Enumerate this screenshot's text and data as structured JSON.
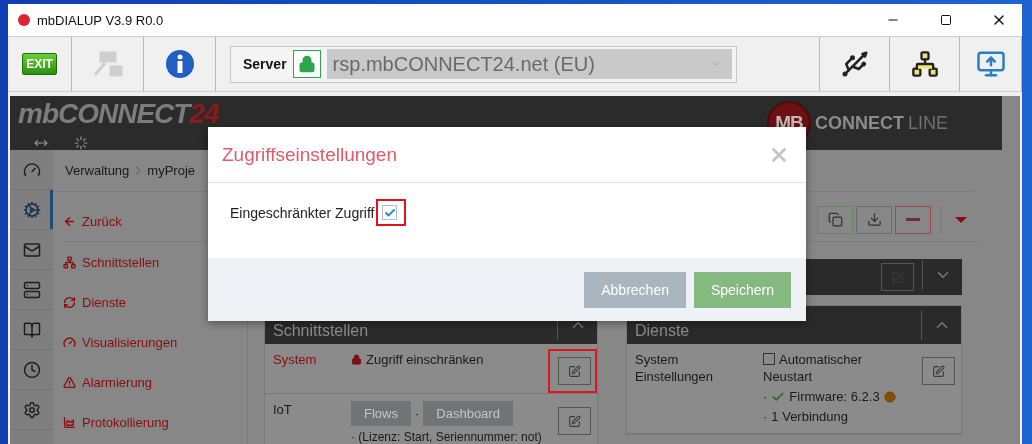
{
  "window": {
    "title": "mbDIALUP V3.9 R0.0"
  },
  "toolbar": {
    "buttons": [
      {
        "kind": "exit",
        "label": "EXIT",
        "disabled": false
      },
      {
        "kind": "connect",
        "disabled": true
      },
      {
        "kind": "info",
        "disabled": false
      }
    ],
    "server": {
      "label": "Server",
      "secure": true,
      "value": "rsp.mbCONNECT24.net (EU)"
    },
    "tools": [
      {
        "kind": "usb"
      },
      {
        "kind": "network"
      },
      {
        "kind": "remote"
      }
    ]
  },
  "header": {
    "logo": "mbCONNECT",
    "logo_accent": "24",
    "brand_mark": "MB",
    "brand_bold": "CONNECT",
    "brand_light": "LINE"
  },
  "sidebar": [
    {
      "kind": "gauge",
      "selected": false
    },
    {
      "kind": "gears",
      "selected": true
    },
    {
      "kind": "mail",
      "selected": false
    },
    {
      "kind": "server",
      "selected": false
    },
    {
      "kind": "book",
      "selected": false
    },
    {
      "kind": "clock",
      "selected": false
    },
    {
      "kind": "gear",
      "selected": false
    }
  ],
  "breadcrumb": [
    "Verwaltung",
    "myProje"
  ],
  "menu": [
    {
      "kind": "back",
      "label": "Zurück"
    },
    {
      "kind": "sitemap",
      "label": "Schnittstellen"
    },
    {
      "kind": "refresh",
      "label": "Dienste"
    },
    {
      "kind": "gauge",
      "label": "Visualisierungen"
    },
    {
      "kind": "warning",
      "label": "Alarmierung"
    },
    {
      "kind": "chart",
      "label": "Protokollierung"
    }
  ],
  "actions": [
    {
      "kind": "copy"
    },
    {
      "kind": "download"
    },
    {
      "kind": "remove"
    },
    {
      "kind": "more"
    }
  ],
  "collapsed_bar": {
    "expanded": false
  },
  "panels": [
    {
      "title": "Schnittstellen",
      "expanded": true,
      "rows": [
        {
          "label": "System",
          "link": true,
          "locked": true,
          "text": "Zugriff einschränken",
          "highlighted": true
        },
        {
          "label": "IoT",
          "link": false,
          "buttons": [
            "Flows",
            "Dashboard"
          ],
          "separator": "·",
          "note": "· (Lizenz: Start, Seriennummer: not)",
          "highlighted": false
        }
      ]
    },
    {
      "title": "Dienste",
      "expanded": true,
      "rows": [
        {
          "label": "System Einstellungen",
          "link": false,
          "highlighted": false,
          "items": [
            {
              "kind": "checkbox",
              "checked": false,
              "text": "Automatischer Neustart"
            },
            {
              "kind": "status",
              "bullet": "·",
              "ok": true,
              "warning": true,
              "text": "Firmware: 6.2.3"
            },
            {
              "kind": "plain",
              "bullet": "·",
              "text": "1 Verbindung"
            }
          ]
        }
      ]
    }
  ],
  "dialog": {
    "title": "Zugriffseinstellungen",
    "field": {
      "label": "Eingeschränkter Zugriff",
      "checked": true,
      "highlighted": true
    },
    "buttons": [
      {
        "kind": "cancel",
        "label": "Abbrechen"
      },
      {
        "kind": "primary",
        "label": "Speichern"
      }
    ]
  }
}
